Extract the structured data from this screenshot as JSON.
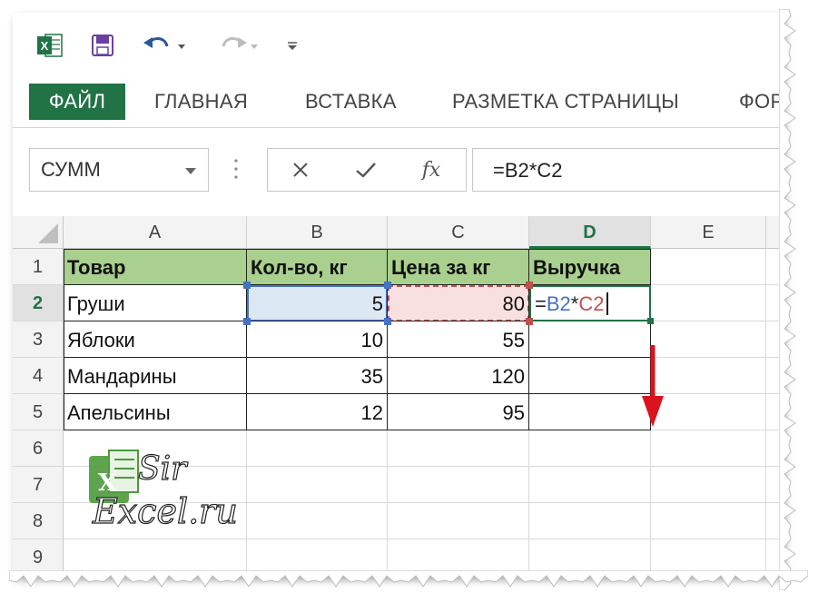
{
  "quick_access": {
    "excel_icon": "excel-icon",
    "save_icon": "save-icon",
    "undo_icon": "undo-icon",
    "redo_icon": "redo-icon",
    "more_icon": "customize-qat-icon"
  },
  "ribbon": {
    "tabs": [
      "ФАЙЛ",
      "ГЛАВНАЯ",
      "ВСТАВКА",
      "РАЗМЕТКА СТРАНИЦЫ",
      "ФОРМУЛЫ"
    ],
    "active_tab": "ФАЙЛ",
    "accent_color": "#217346"
  },
  "formula_bar": {
    "name_box": "СУММ",
    "cancel_icon": "cancel-icon",
    "enter_icon": "check-icon",
    "fx_label": "fx",
    "formula": "=B2*C2"
  },
  "sheet": {
    "columns": [
      "A",
      "B",
      "C",
      "D",
      "E"
    ],
    "active_column": "D",
    "rows": [
      "1",
      "2",
      "3",
      "4",
      "5",
      "6",
      "7",
      "8",
      "9"
    ],
    "active_row": "2",
    "header": [
      "Товар",
      "Кол-во, кг",
      "Цена за кг",
      "Выручка"
    ],
    "data": [
      {
        "product": "Груши",
        "qty": "5",
        "price": "80"
      },
      {
        "product": "Яблоки",
        "qty": "10",
        "price": "55"
      },
      {
        "product": "Мандарины",
        "qty": "35",
        "price": "120"
      },
      {
        "product": "Апельсины",
        "qty": "12",
        "price": "95"
      }
    ],
    "editing_cell": {
      "ref": "D2",
      "parts": [
        {
          "text": "=",
          "color": "#222222"
        },
        {
          "text": "B2",
          "color": "#4472c4"
        },
        {
          "text": "*",
          "color": "#222222"
        },
        {
          "text": "C2",
          "color": "#c0504d"
        }
      ]
    },
    "header_fill": "#a9d08e",
    "ref_b2_color": "#4472c4",
    "ref_c2_color": "#c0504d"
  },
  "watermark": {
    "line1": "Sir",
    "line2": "Excel.ru"
  },
  "annotation": {
    "arrow_color": "#d9141e",
    "arrow_icon": "down-arrow-icon"
  }
}
